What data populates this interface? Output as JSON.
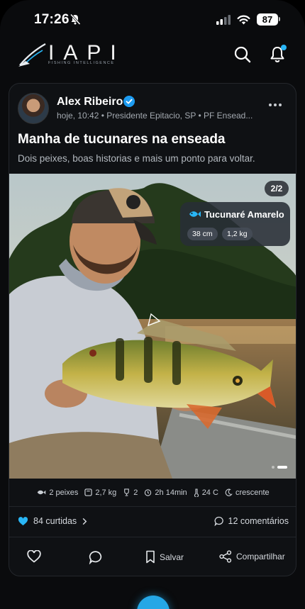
{
  "status_bar": {
    "time": "17:26",
    "battery": "87"
  },
  "brand": {
    "name": "IAPI",
    "tagline": "FISHING INTELLIGENCE"
  },
  "post": {
    "author": "Alex Ribeiro",
    "meta": "hoje, 10:42 • Presidente Epitacio, SP • PF Ensead...",
    "title": "Manha de tucunares na enseada",
    "description": "Dois peixes, boas historias e mais um ponto para voltar.",
    "photo_counter": "2/2",
    "fish_tag": {
      "species": "Tucunaré Amarelo",
      "length": "38 cm",
      "weight": "1,2 kg"
    },
    "stats": {
      "fish": "2 peixes",
      "weight": "2,7 kg",
      "trophies": "2",
      "duration": "2h 14min",
      "temperature": "24 C",
      "moon": "crescente"
    },
    "likes": "84 curtidas",
    "comments": "12 comentários",
    "actions": {
      "save": "Salvar",
      "share": "Compartilhar"
    }
  },
  "colors": {
    "accent": "#29b6f6",
    "background": "#0a0b0d",
    "card": "#0f1114"
  }
}
